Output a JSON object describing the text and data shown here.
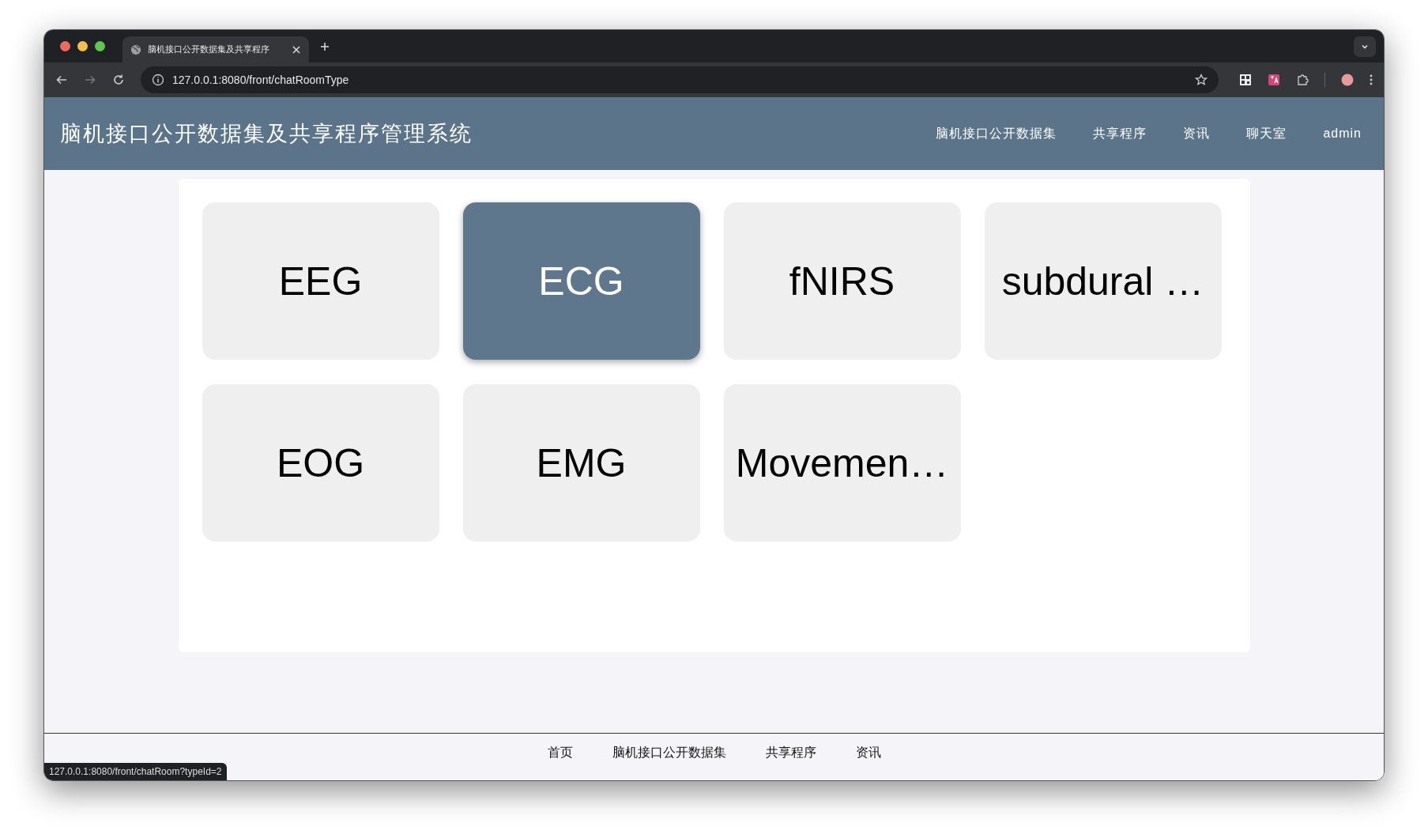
{
  "browser": {
    "tab_title": "脑机接口公开数据集及共享程序",
    "url": "127.0.0.1:8080/front/chatRoomType",
    "status_url": "127.0.0.1:8080/front/chatRoom?typeId=2"
  },
  "header": {
    "title": "脑机接口公开数据集及共享程序管理系统",
    "nav": [
      "脑机接口公开数据集",
      "共享程序",
      "资讯",
      "聊天室",
      "admin"
    ]
  },
  "room_types": [
    {
      "label": "EEG",
      "selected": false
    },
    {
      "label": "ECG",
      "selected": true
    },
    {
      "label": "fNIRS",
      "selected": false
    },
    {
      "label": "subdural …",
      "selected": false
    },
    {
      "label": "EOG",
      "selected": false
    },
    {
      "label": "EMG",
      "selected": false
    },
    {
      "label": "Movemen…",
      "selected": false
    }
  ],
  "footer": {
    "nav": [
      "首页",
      "脑机接口公开数据集",
      "共享程序",
      "资讯"
    ]
  }
}
